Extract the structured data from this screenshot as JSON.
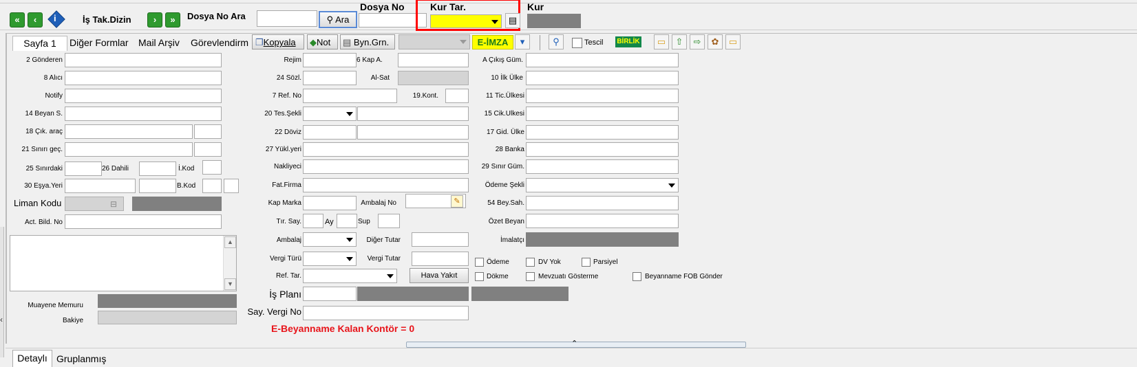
{
  "top": {
    "is_tak_dizin": "İş Tak.Dizin",
    "dosya_no_ara": "Dosya No Ara",
    "ara_btn": "Ara",
    "dosya_no_label": "Dosya No",
    "kur_tar_label": "Kur Tar.",
    "kur_label": "Kur"
  },
  "tabs": {
    "sayfa1": "Sayfa 1",
    "diger": "Diğer Formlar",
    "mail": "Mail Arşiv",
    "gorev": "Görevlendirm",
    "kopyala": "Kopyala",
    "not": "Not",
    "byn": "Byn.Grn.",
    "eimza": "E-İMZA",
    "tescil": "Tescil",
    "birlik": "BİRLİK"
  },
  "left": {
    "gonderen": "2 Gönderen",
    "alici": "8 Alıcı",
    "notify": "Notify",
    "beyan": "14 Beyan S.",
    "cik_arac": "18 Çık. araç",
    "sinir_gec": "21 Sınırı geç.",
    "sinirdaki": "25 Sınırdaki",
    "dahili": "26 Dahili",
    "ikod": "İ.Kod",
    "esya_yeri": "30 Eşya.Yeri",
    "bkod": "B.Kod",
    "liman": "Liman Kodu",
    "act_bild": "Act. Bild. No",
    "muayene": "Muayene Memuru",
    "bakiye": "Bakiye"
  },
  "mid": {
    "rejim": "Rejim",
    "kap_a": "6 Kap A.",
    "sozl": "24 Sözl.",
    "alsat": "Al-Sat",
    "refno": "7 Ref. No",
    "kont": "19.Kont.",
    "tessekli": "20 Tes.Şekli",
    "doviz": "22 Döviz",
    "yukl": "27 Yükl.yeri",
    "nakliyeci": "Nakliyeci",
    "fatfirma": "Fat.Firma",
    "kapmarka": "Kap Marka",
    "ambalajno": "Ambalaj No",
    "tirsay": "Tır. Say.",
    "ay": "Ay",
    "sup": "Sup",
    "ambalaj": "Ambalaj",
    "digertutar": "Diğer Tutar",
    "vergituru": "Vergi Türü",
    "vergitutar": "Vergi Tutar",
    "reftar": "Ref. Tar.",
    "havayakit": "Hava Yakıt",
    "isplani": "İş Planı",
    "sayvergi": "Say. Vergi No",
    "kontor": "E-Beyanname Kalan Kontör = 0"
  },
  "right": {
    "cikis": "A Çıkış Güm.",
    "ilk": "10 İlk Ülke",
    "tic": "11 Tic.Ülkesi",
    "cik": "15 Cik.Ulkesi",
    "gid": "17 Gid. Ülke",
    "banka": "28 Banka",
    "sinir": "29 Sınır Güm.",
    "odeme": "Ödeme Şekli",
    "bey": "54 Bey.Sah.",
    "ozet": "Özet Beyan",
    "imalatci": "İmalatçı"
  },
  "checks": {
    "odeme": "Ödeme",
    "dvyok": "DV Yok",
    "parsiyel": "Parsiyel",
    "dokme": "Dökme",
    "mevzuati": "Mevzuatı Gösterme",
    "fob": "Beyanname FOB Gönder"
  },
  "bottom": {
    "detayli": "Detaylı",
    "gruplanmis": "Gruplanmış"
  },
  "colors": {
    "highlight": "#ff0000",
    "yellow_field": "#ffff00",
    "kontor_text": "#e8141a",
    "eimza_bg": "#ffff00"
  }
}
